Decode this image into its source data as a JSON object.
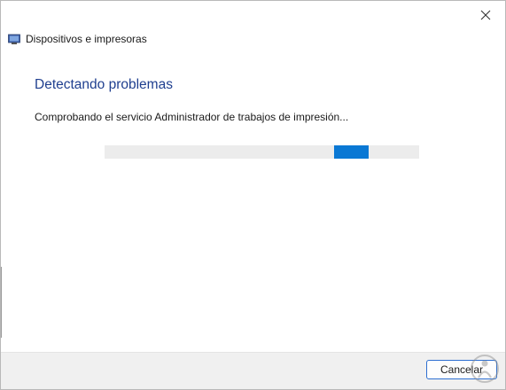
{
  "window": {
    "title": "Dispositivos e impresoras",
    "close_glyph": "✕"
  },
  "main": {
    "heading": "Detectando problemas",
    "status": "Comprobando el servicio Administrador de trabajos de impresión..."
  },
  "footer": {
    "cancel_label": "Cancelar"
  },
  "icons": {
    "title_icon": "devices-printers-icon",
    "close_icon": "close-icon",
    "watermark": "solvetic-logo"
  },
  "colors": {
    "heading": "#1f3f8f",
    "progress_chunk": "#0a78d4",
    "progress_track": "#ececec",
    "footer_bg": "#f0f0f0",
    "button_border": "#2d6fd1"
  }
}
